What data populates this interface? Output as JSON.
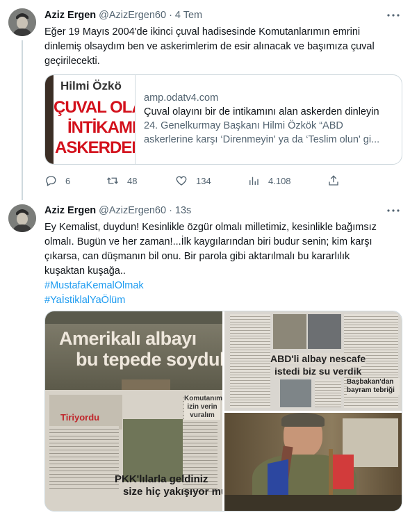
{
  "tweets": [
    {
      "name": "Aziz Ergen",
      "handle": "@AzizErgen60",
      "separator": "·",
      "time": "4 Tem",
      "text_lines": [
        "Eğer 19 Mayıs 2004'de  ikinci çuval hadisesinde Komutanlarımın emrini",
        "dinlemiş olsaydım ben  ve askerimlerim de esir alınacak ve başımıza çuval",
        "geçirilecekti."
      ],
      "card": {
        "thumb_lines": [
          "Hilmi Özkö",
          "ÇUVAL OLAY",
          "İNTİKAMI",
          "ASKERDEN"
        ],
        "domain": "amp.odatv4.com",
        "title": "Çuval olayını bir de intikamını alan askerden dinleyin",
        "desc_line1": "24. Genelkurmay Başkanı Hilmi Özkök “ABD",
        "desc_line2": "askerlerine karşı ‘Direnmeyin' ya da ‘Teslim olun' gi..."
      },
      "stats": {
        "replies": "6",
        "retweets": "48",
        "likes": "134",
        "views": "4.108"
      }
    },
    {
      "name": "Aziz Ergen",
      "handle": "@AzizErgen60",
      "separator": "·",
      "time": "13s",
      "text_lines": [
        "Ey Kemalist, duydun! Kesinlikle özgür olmalı milletimiz, kesinlikle bağımsız",
        "olmalı. Bugün ve her zaman!...İlk kaygılarından biri budur senin; kim karşı",
        "çıkarsa, can düşmanın bil onu. Bir parola gibi aktarılmalı bu kararlılık",
        "kuşaktan kuşağa.."
      ],
      "hashtags": [
        "#MustafaKemalOlmak",
        "#YaİstiklalYaÖlüm"
      ],
      "media": {
        "newspaper1_headline1": "Amerikalı albayı",
        "newspaper1_headline2": "bu tepede soyduk",
        "newspaper1_footer1": "PKK'lılarla geldiniz",
        "newspaper1_footer2": "size hiç yakışıyor mu",
        "newspaper1_box": "Komutanım izin verin vuralım",
        "newspaper1_caption": "Tiriyordu",
        "newspaper2_headline1": "ABD'li albay nescafe",
        "newspaper2_headline2": "istedi biz su verdik",
        "newspaper2_side": "Başbakan'dan bayram tebriği"
      }
    }
  ],
  "icons": {
    "more": "more-icon",
    "reply": "reply-icon",
    "retweet": "retweet-icon",
    "like": "like-icon",
    "views": "views-icon",
    "share": "share-icon"
  },
  "colors": {
    "link": "#1d9bf0",
    "secondary": "#536471",
    "text": "#0f1419",
    "border": "#cfd9de"
  }
}
